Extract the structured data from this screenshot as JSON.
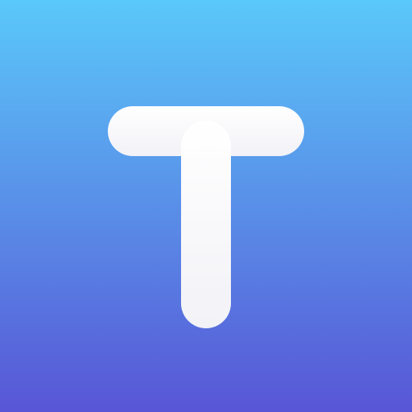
{
  "icon": {
    "glyph": "T",
    "glyph_name": "t-letter-icon",
    "colors": {
      "gradient_top": "#5AC8FA",
      "gradient_bottom": "#5856D6",
      "glyph_top": "#FFFFFF",
      "glyph_bottom": "#F2F2F7"
    }
  }
}
